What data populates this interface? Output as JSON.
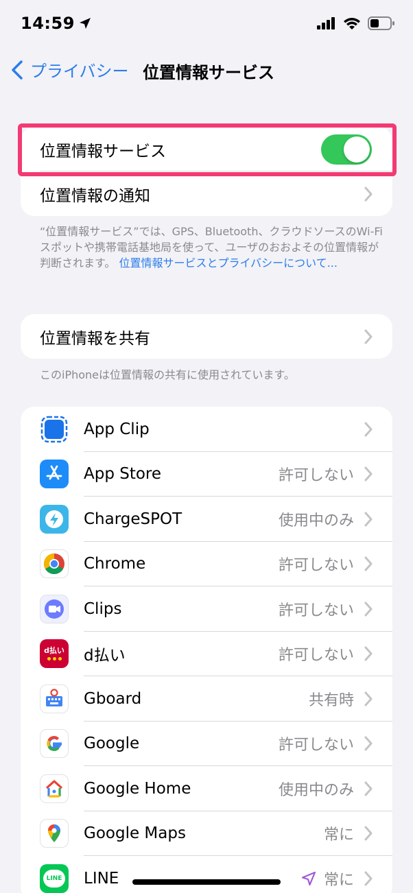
{
  "status": {
    "time": "14:59"
  },
  "nav": {
    "back_label": "プライバシー",
    "title": "位置情報サービス"
  },
  "location_services": {
    "label": "位置情報サービス",
    "enabled": true
  },
  "location_alerts": {
    "label": "位置情報の通知"
  },
  "footnote1": {
    "text": "“位置情報サービス”では、GPS、Bluetooth、クラウドソースのWi-Fiスポットや携帯電話基地局を使って、ユーザのおおよその位置情報が判断されます。",
    "link": "位置情報サービスとプライバシーについて..."
  },
  "share_location": {
    "label": "位置情報を共有"
  },
  "footnote2": {
    "text": "このiPhoneは位置情報の共有に使用されています。"
  },
  "apps": [
    {
      "name": "App Clip",
      "value": ""
    },
    {
      "name": "App Store",
      "value": "許可しない"
    },
    {
      "name": "ChargeSPOT",
      "value": "使用中のみ"
    },
    {
      "name": "Chrome",
      "value": "許可しない"
    },
    {
      "name": "Clips",
      "value": "許可しない"
    },
    {
      "name": "d払い",
      "value": "許可しない"
    },
    {
      "name": "Gboard",
      "value": "共有時"
    },
    {
      "name": "Google",
      "value": "許可しない"
    },
    {
      "name": "Google Home",
      "value": "使用中のみ"
    },
    {
      "name": "Google Maps",
      "value": "常に"
    },
    {
      "name": "LINE",
      "value": "常に"
    }
  ],
  "icon_labels": {
    "dpay": "d払い",
    "line": "LINE"
  },
  "colors": {
    "accent": "#2b7de9",
    "toggle_on": "#34c759",
    "highlight": "#f23a73"
  }
}
